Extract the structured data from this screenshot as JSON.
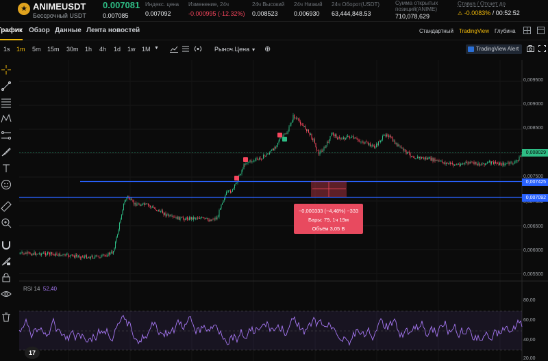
{
  "ticker": {
    "symbol": "ANIMEUSDT",
    "subtitle": "Бессрочный USDT",
    "last_price": "0.007081",
    "mark_price": "0.007085",
    "stats": [
      {
        "label": "Индекс. цена",
        "value": "0.007092",
        "color": "#eaecef"
      },
      {
        "label": "Изменение, 24ч",
        "value": "-0.000995 (-12.32%)",
        "color": "#f6465d"
      },
      {
        "label": "24ч Высокий",
        "value": "0.008523",
        "color": "#eaecef"
      },
      {
        "label": "24ч Низкий",
        "value": "0.006930",
        "color": "#eaecef"
      },
      {
        "label": "24ч Оборот(USDT)",
        "value": "63,444,848.53",
        "color": "#eaecef"
      },
      {
        "label": "Сумма открытых позиций(ANIME)",
        "value": "710,078,629",
        "color": "#eaecef"
      }
    ],
    "funding_label": "Ставка / Отсчет до",
    "funding_rate": "-0.0083%",
    "funding_sep": " / ",
    "funding_timer": "00:52:52"
  },
  "tabs": [
    "График",
    "Обзор",
    "Данные",
    "Лента новостей"
  ],
  "views": [
    "Стандартный",
    "TradingView",
    "Глубина"
  ],
  "toolbar": {
    "timeframes": [
      "1s",
      "1m",
      "5m",
      "15m",
      "30m",
      "1h",
      "4h",
      "1d",
      "1w",
      "1M"
    ],
    "active_timeframe": "1m",
    "market_price_label": "Рыноч.Цена",
    "tv_alert": "TradingView Alert"
  },
  "price_axis": [
    "0,009500",
    "0,009000",
    "0,008500",
    "0,007500",
    "0,007000",
    "0,006500",
    "0,006000",
    "0,005500"
  ],
  "price_labels": [
    {
      "value": "0,008029",
      "color": "#2ebd85"
    },
    {
      "value": "0,007425",
      "color": "#2962ff"
    },
    {
      "value": "0,007092",
      "color": "#2962ff"
    }
  ],
  "measure_tooltip": {
    "line1": "−0,000333 (−4,48%) −333",
    "line2": "Бары: 79, 1ч 19м",
    "line3": "Объём 3,05 В"
  },
  "rsi": {
    "title": "RSI 14",
    "value": "52,40",
    "axis": [
      "80,00",
      "60,00",
      "40,00",
      "20,00"
    ]
  },
  "colors": {
    "up": "#2ebd85",
    "down": "#f6465d",
    "accent": "#f0b90b",
    "rsi_line": "#a778f5",
    "hline": "#2962ff"
  }
}
